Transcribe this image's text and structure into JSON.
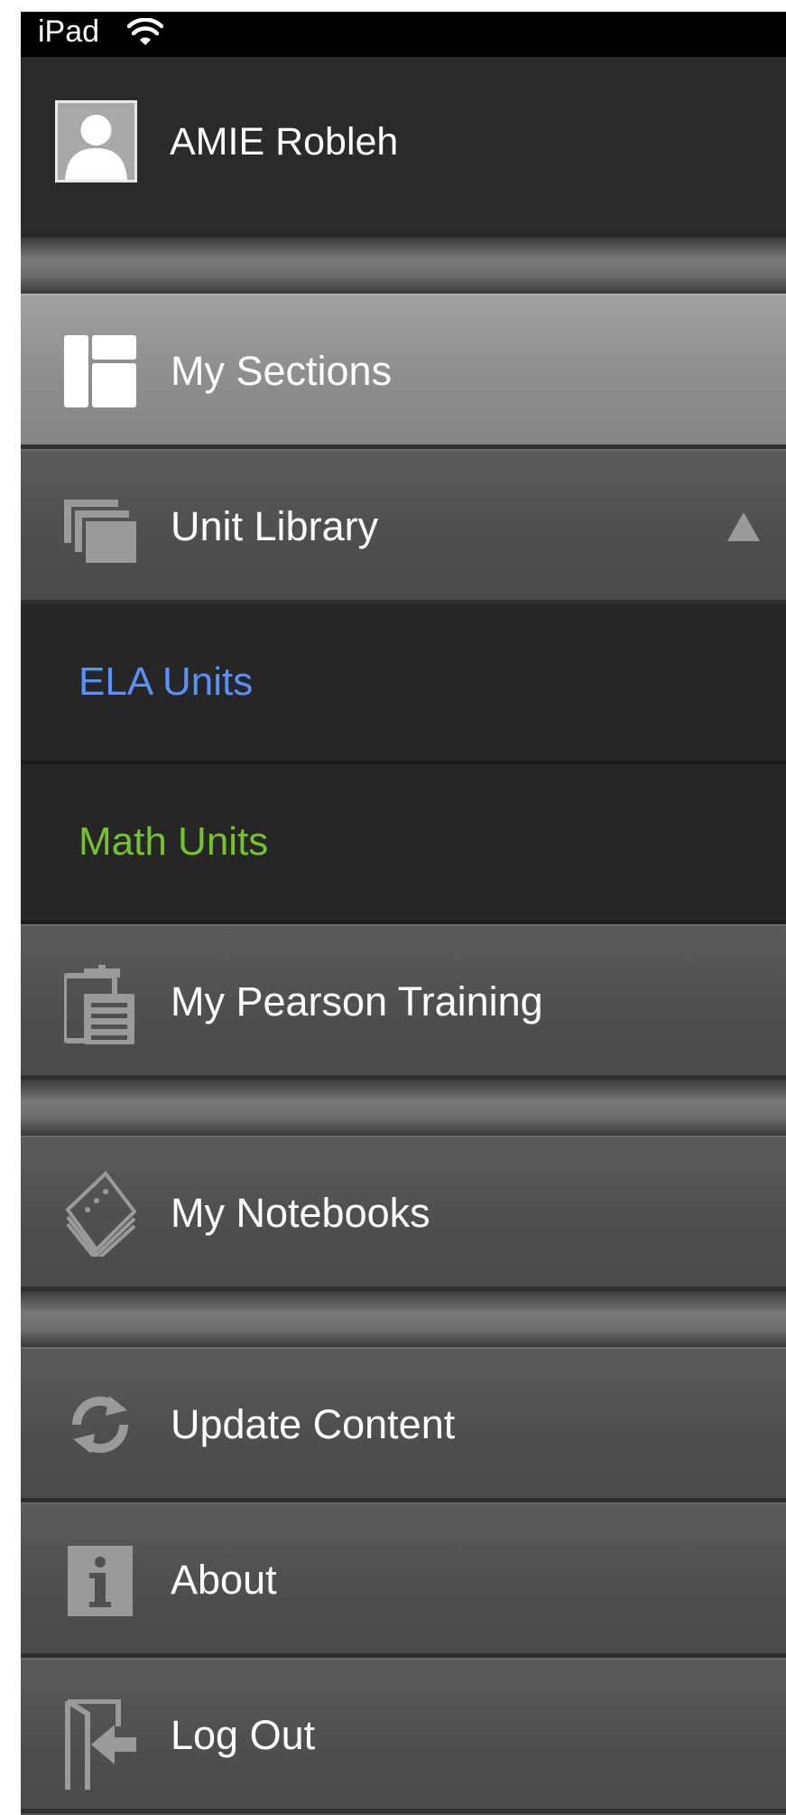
{
  "status_bar": {
    "device_label": "iPad",
    "wifi_icon": "wifi-icon"
  },
  "user": {
    "name": "AMIE Robleh",
    "avatar_icon": "user-avatar-icon"
  },
  "menu": {
    "my_sections": {
      "label": "My Sections",
      "icon": "sections-layout-icon",
      "selected": true
    },
    "unit_library": {
      "label": "Unit Library",
      "icon": "stacked-cards-icon",
      "expanded": true
    },
    "unit_library_children": [
      {
        "label": "ELA Units",
        "color": "#5b8ff9"
      },
      {
        "label": "Math Units",
        "color": "#76c12e"
      }
    ],
    "pearson_training": {
      "label": "My Pearson Training",
      "icon": "clipboard-icon"
    },
    "notebooks": {
      "label": "My Notebooks",
      "icon": "notebooks-icon"
    },
    "update_content": {
      "label": "Update Content",
      "icon": "refresh-icon"
    },
    "about": {
      "label": "About",
      "icon": "info-icon"
    },
    "log_out": {
      "label": "Log Out",
      "icon": "logout-icon"
    }
  },
  "colors": {
    "status_bar": "#000000",
    "header": "#2a2a2a",
    "menu_item": "#505050",
    "selected_item": "#8f8f8f",
    "submenu": "#262626"
  }
}
